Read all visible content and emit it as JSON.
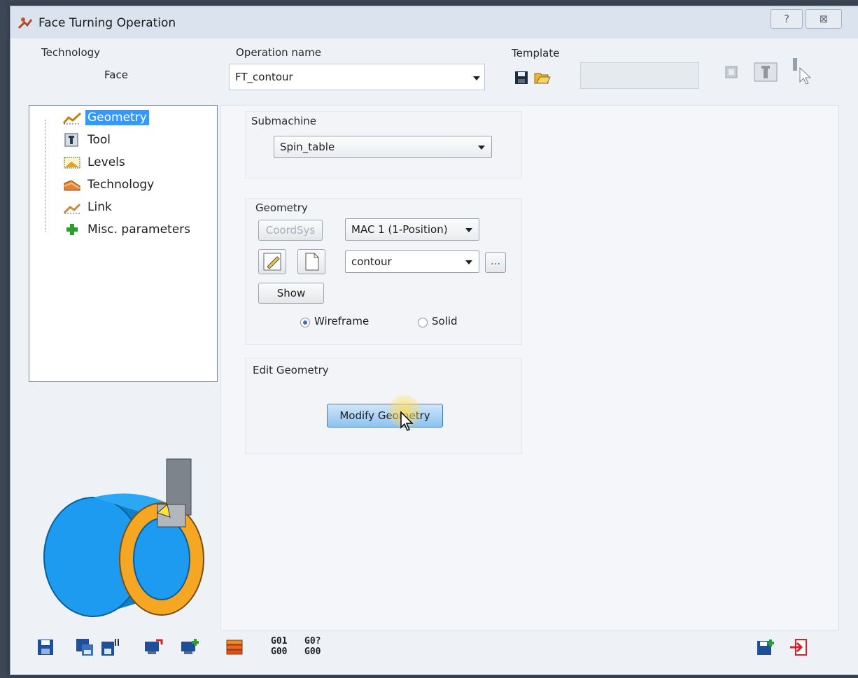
{
  "window": {
    "title": "Face Turning Operation"
  },
  "titlebar_buttons": {
    "help_glyph": "?",
    "close_glyph": "⊠"
  },
  "header": {
    "technology_label": "Technology",
    "technology_value": "Face",
    "operation_name_label": "Operation name",
    "operation_name_value": "FT_contour",
    "template_label": "Template"
  },
  "tree": {
    "items": [
      {
        "label": "Geometry",
        "icon": "geometry-icon",
        "selected": true
      },
      {
        "label": "Tool",
        "icon": "tool-icon"
      },
      {
        "label": "Levels",
        "icon": "levels-icon"
      },
      {
        "label": "Technology",
        "icon": "technology-icon"
      },
      {
        "label": "Link",
        "icon": "link-icon"
      },
      {
        "label": "Misc. parameters",
        "icon": "plus-icon"
      }
    ]
  },
  "submachine": {
    "label": "Submachine",
    "value": "Spin_table"
  },
  "geometry": {
    "label": "Geometry",
    "coordsys_button": "CoordSys",
    "coordsys_value": "MAC 1 (1-Position)",
    "geometry_value": "contour",
    "browse_button": "...",
    "show_button": "Show",
    "radio_wireframe": "Wireframe",
    "radio_solid": "Solid",
    "selected_mode": "Wireframe"
  },
  "edit_geometry": {
    "label": "Edit Geometry",
    "modify_button": "Modify Geometry"
  },
  "bottom_toolbar": {
    "gcode_1_top": "G01",
    "gcode_1_bottom": "G00",
    "gcode_2_top": "G0?",
    "gcode_2_bottom": "G00"
  },
  "colors": {
    "accent": "#3399ff",
    "part_blue": "#1c9bf0",
    "part_orange": "#f5a623",
    "exit_red": "#d9232a"
  }
}
